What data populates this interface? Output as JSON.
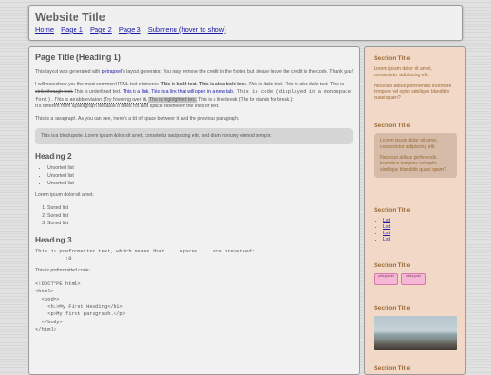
{
  "header": {
    "site_title": "Website Title",
    "nav": [
      "Home",
      "Page 1",
      "Page 2",
      "Page 3",
      "Submenu (hover to show)"
    ]
  },
  "main": {
    "page_title": "Page Title (Heading 1)",
    "intro_1": "This layout was generated with ",
    "intro_link": "petrapixel",
    "intro_2": "'s layout generator. You may remove the credit in the footer, but please leave the credit in the code. Thank you!",
    "elements_intro": "I will now show you the most common HTML text elements: ",
    "bold_text": "This is bold text. This is also bold text.",
    "italic_text": " This is italic text.",
    "italic_text2": " This is also italic text.",
    "strike_text": " This is strikethrough text.",
    "underline_text": " This is underlined text.",
    "link_text": " This is a link.",
    "newtab_link": " This is a link that will open in a new tab.",
    "code_text": " This is code (displayed in a monospace font).",
    "abbr_text": " This is an abbreviation (Try hovering over it).",
    "highlight_text": " This is highlighted text.",
    "break_text": " This is a line break (The br stands for break.):",
    "break_text2": "It's different from a paragraph because it does not add space inbetween the lines of text.",
    "para_text": "This is a paragraph. As you can see, there's a bit of space between it and the previous paragraph.",
    "blockquote": "This is a blockquote. Lorem ipsum dolor sit amet, consetetur sadipscing elitr, sed diam nonumy eirmod tempor.",
    "heading2": "Heading 2",
    "unsorted": [
      "Unsorted list",
      "Unsorted list",
      "Unsorted list"
    ],
    "lorem": "Lorem ipsum dolor sit amet.",
    "sorted": [
      "Sorted list",
      "Sorted list",
      "Sorted list"
    ],
    "heading3": "Heading 3",
    "pre_text": "This is preformatted text, which means that     spaces     are preserved:\n          :0",
    "pre_code_label": "This is preformatted code:",
    "pre_code": "<!DOCTYPE html>\n<html>\n  <body>\n    <h1>My First Heading</h1>\n    <p>My first paragraph.</p>\n  </body>\n</html>"
  },
  "sidebar": {
    "sec1_title": "Section Title",
    "sec1_p1": "Lorem ipsum dolor sit amet, consectetur adipiscing elit.",
    "sec1_p2": "Necessit atibus perferendis inventore tempore vel optio similique blanditiis quasi quam?",
    "sec2_title": "Section Title",
    "sec2_p1": "Lorem ipsum dolor sit amet, consectetur adipiscing elit.",
    "sec2_p2": "Necessit atibus perferendis inventore tempore vel optio similique blanditiis quasi quam?",
    "sec3_title": "Section Title",
    "list": [
      "List",
      "List",
      "List",
      "List"
    ],
    "sec4_title": "Section Title",
    "badges": [
      "petra pixel",
      "petra pixel"
    ],
    "sec5_title": "Section Title",
    "sec6_title": "Section Title"
  }
}
